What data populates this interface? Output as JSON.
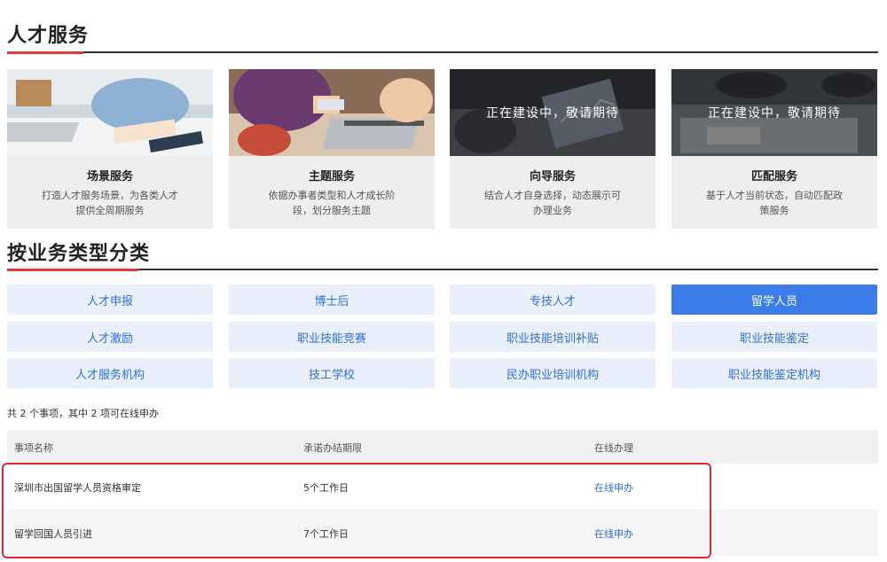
{
  "sections": {
    "talent_services_title": "人才服务",
    "business_type_title": "按业务类型分类"
  },
  "cards": [
    {
      "title": "场景服务",
      "desc": "打造人才服务场景，为各类人才提供全周期服务",
      "overlay": ""
    },
    {
      "title": "主题服务",
      "desc": "依据办事者类型和人才成长阶段，划分服务主题",
      "overlay": ""
    },
    {
      "title": "向导服务",
      "desc": "结合人才自身选择，动态展示可办理业务",
      "overlay": "正在建设中，敬请期待"
    },
    {
      "title": "匹配服务",
      "desc": "基于人才当前状态，自动匹配政策服务",
      "overlay": "正在建设中，敬请期待"
    }
  ],
  "categories": [
    "人才申报",
    "博士后",
    "专技人才",
    "留学人员",
    "人才激励",
    "职业技能竞赛",
    "职业技能培训补贴",
    "职业技能鉴定",
    "人才服务机构",
    "技工学校",
    "民办职业培训机构",
    "职业技能鉴定机构"
  ],
  "active_category": "留学人员",
  "summary": "共 2 个事项，其中 2 项可在线申办",
  "table": {
    "headers": [
      "事项名称",
      "承诺办结期限",
      "在线办理"
    ],
    "rows": [
      {
        "name": "深圳市出国留学人员资格审定",
        "deadline": "5个工作日",
        "action": "在线申办"
      },
      {
        "name": "留学回国人员引进",
        "deadline": "7个工作日",
        "action": "在线申办"
      }
    ]
  },
  "colors": {
    "accent_red": "#e23a3a",
    "category_blue": "#3b7de9",
    "link_blue": "#2f6fd8"
  }
}
